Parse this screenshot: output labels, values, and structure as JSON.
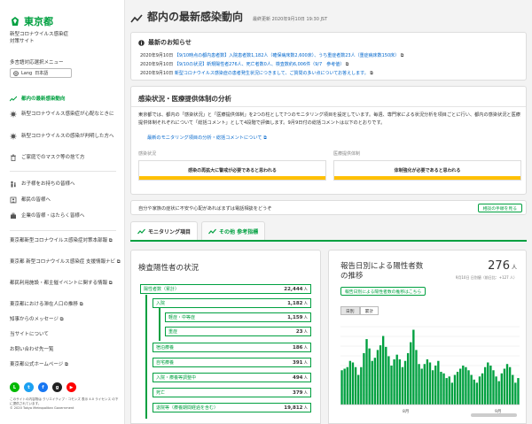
{
  "sidebar": {
    "logo": "東京都",
    "subtitle": [
      "新型コロナウイルス感染症",
      "対策サイト"
    ],
    "region_label": "多言語対応選択メニュー",
    "lang_label": "Lang",
    "lang_value": "日本語",
    "nav": [
      {
        "label": "都内の最新感染動向",
        "icon": "chart-icon"
      },
      {
        "label": "新型コロナウイルス感染症が心配なときに",
        "icon": "virus-icon"
      },
      {
        "label": "新型コロナウイルスの感染が判明した方へ",
        "icon": "virus-icon"
      },
      {
        "label": "ご家庭でのマスク等の捨て方",
        "icon": "trash-icon"
      },
      {
        "label": "お子様をお持ちの皆様へ",
        "icon": "family-icon"
      },
      {
        "label": "都民の皆様へ",
        "icon": "people-icon"
      },
      {
        "label": "企業の皆様・はたらく皆様へ",
        "icon": "building-icon"
      }
    ],
    "links": [
      "東京都新型コロナウイルス感染症対策本部報",
      "東京都 新型コロナウイルス感染症 支援情報ナビ",
      "都民利用施設・都主催イベントに関する情報",
      "東京都における滞在人口の推移",
      "知事からのメッセージ",
      "当サイトについて",
      "お問い合わせ先一覧",
      "東京都公式ホームページ"
    ],
    "copyright_1": "このサイトの内容物は クリエイティブ・コモンズ 表示 4.0 ライセンス の下に提供されています。",
    "copyright_2": "© 2020 Tokyo Metropolitan Government"
  },
  "header": {
    "title": "都内の最新感染動向",
    "updated": "最終更新 2020年9月10日 19:30 JST"
  },
  "news": {
    "title": "最新のお知らせ",
    "items": [
      {
        "date": "2020年9月10日",
        "link": "【9/10時点の都内患者数】入院患者数1,182人（確保病床数2,600床）、うち重症者数23人（重症病床数150床）",
        "ext": "⧉"
      },
      {
        "date": "2020年9月10日",
        "link": "【9/10の状況】新規陽性者276人、死亡者数0人、検査数約6,006件（9/7　参考値）",
        "ext": "⧉"
      },
      {
        "date": "2020年9月10日",
        "link": "新型コロナウイルス感染症の患者発生状況につきまして、ご質問の多い点についてお答えします。",
        "ext": "⧉"
      }
    ]
  },
  "analysis": {
    "title": "感染状況・医療提供体制の分析",
    "body": "東京都では、都内の「感染状況」と「医療提供体制」を2つの柱として7つのモニタリング項目を設定しています。毎週、専門家による状況分析を項目ごとに行い、都内の感染状況と医療提供体制それぞれについて「総括コメント」として4段階で評価します。9月9日付の総括コメントは以下のとおりです。",
    "link": "最新のモニタリング項目の分析・総括コメントについて",
    "infection_label": "感染状況",
    "infection_value": "感染の再拡大に警戒が必要であると思われる",
    "medical_label": "医療提供体制",
    "medical_value": "体制強化が必要であると思われる"
  },
  "consult": {
    "text": "自分や家族の症状に不安や心配があればまずは電話相談をどうぞ",
    "button": "相談の手順を見る"
  },
  "tabs": [
    {
      "label": "モニタリング項目"
    },
    {
      "label": "その他 参考指標"
    }
  ],
  "cases": {
    "title": "検査陽性者の状況",
    "unit": "人",
    "rows": [
      {
        "label": "陽性者数（累計）",
        "value": "22,444"
      },
      {
        "label": "入院",
        "value": "1,182"
      },
      {
        "label": "軽症・中等症",
        "value": "1,159"
      },
      {
        "label": "重症",
        "value": "23"
      },
      {
        "label": "宿泊療養",
        "value": "186"
      },
      {
        "label": "自宅療養",
        "value": "391"
      },
      {
        "label": "入院・療養等調整中",
        "value": "494"
      },
      {
        "label": "死亡",
        "value": "379"
      },
      {
        "label": "退院等（療養期間経過を含む）",
        "value": "19,812"
      }
    ]
  },
  "daily": {
    "title": "報告日別による陽性者数の推移",
    "value": "276",
    "unit": "人",
    "sub": "9月10日 日別値（前日比：+127 人）",
    "button": "報告日別による陽性者数の推移はこちら",
    "toggle_on": "日別",
    "toggle_off": "累計"
  },
  "chart_data": {
    "type": "bar",
    "x_tick_labels": [
      "8月",
      "9月"
    ],
    "values": [
      44,
      46,
      48,
      56,
      54,
      48,
      38,
      48,
      66,
      84,
      72,
      56,
      60,
      70,
      76,
      88,
      74,
      62,
      50,
      58,
      64,
      58,
      48,
      56,
      66,
      80,
      96,
      70,
      52,
      46,
      52,
      58,
      54,
      44,
      50,
      56,
      42,
      40,
      34,
      36,
      28,
      38,
      42,
      46,
      50,
      48,
      44,
      38,
      32,
      28,
      36,
      40,
      48,
      54,
      50,
      44,
      36,
      30,
      40,
      46,
      52,
      48,
      38,
      28,
      34
    ],
    "color": "#00a040",
    "grid": true
  }
}
